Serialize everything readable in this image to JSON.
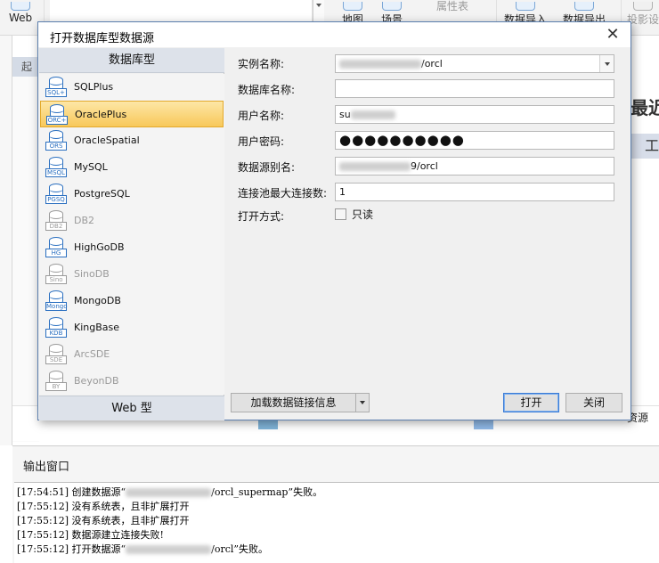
{
  "ribbon": {
    "web_label": "Web",
    "map_label": "地图",
    "scene_label": "场景",
    "properties_label": "属性表",
    "data_import_label": "数据导入",
    "data_export_label": "数据导出",
    "projection_label": "投影设"
  },
  "background": {
    "start_tab": "起",
    "recent_title": "最近",
    "tool_label": "工",
    "resource_text": "资源"
  },
  "dialog": {
    "title": "打开数据库型数据源",
    "close_icon": "close-icon",
    "panel_header": "数据库型",
    "web_tab": "Web 型",
    "datasource_types": [
      {
        "label": "SQLPlus",
        "tag": "SQL+",
        "enabled": true,
        "selected": false
      },
      {
        "label": "OraclePlus",
        "tag": "ORC+",
        "enabled": true,
        "selected": true
      },
      {
        "label": "OracleSpatial",
        "tag": "ORS",
        "enabled": true,
        "selected": false
      },
      {
        "label": "MySQL",
        "tag": "MSQL",
        "enabled": true,
        "selected": false
      },
      {
        "label": "PostgreSQL",
        "tag": "PGSQ",
        "enabled": true,
        "selected": false
      },
      {
        "label": "DB2",
        "tag": "DB2",
        "enabled": false,
        "selected": false
      },
      {
        "label": "HighGoDB",
        "tag": "HG",
        "enabled": true,
        "selected": false
      },
      {
        "label": "SinoDB",
        "tag": "Sino",
        "enabled": false,
        "selected": false
      },
      {
        "label": "MongoDB",
        "tag": "Mongo",
        "enabled": true,
        "selected": false
      },
      {
        "label": "KingBase",
        "tag": "KDB",
        "enabled": true,
        "selected": false
      },
      {
        "label": "ArcSDE",
        "tag": "SDE",
        "enabled": false,
        "selected": false
      },
      {
        "label": "BeyonDB",
        "tag": "BY",
        "enabled": false,
        "selected": false
      }
    ],
    "form": {
      "instance_label": "实例名称:",
      "instance_value": "/orcl",
      "database_label": "数据库名称:",
      "database_value": "",
      "user_label": "用户名称:",
      "user_value": "su",
      "password_label": "用户密码:",
      "password_value": "●●●●●●●●●●",
      "alias_label": "数据源别名:",
      "alias_value": "9/orcl",
      "pool_label": "连接池最大连接数:",
      "pool_value": "1",
      "open_mode_label": "打开方式:",
      "readonly_label": "只读"
    },
    "buttons": {
      "load_link": "加载数据链接信息",
      "open": "打开",
      "close": "关闭"
    }
  },
  "output": {
    "title": "输出窗口",
    "log": [
      "[17:54:51] 创建数据源“",
      "[17:55:12] 没有系统表，且非扩展打开",
      "[17:55:12] 没有系统表，且非扩展打开",
      "[17:55:12] 数据源建立连接失败!",
      "[17:55:12] 打开数据源“"
    ],
    "log_tail": {
      "line0": "/orcl_supermap”失败。",
      "line4": "/orcl”失败。"
    }
  }
}
